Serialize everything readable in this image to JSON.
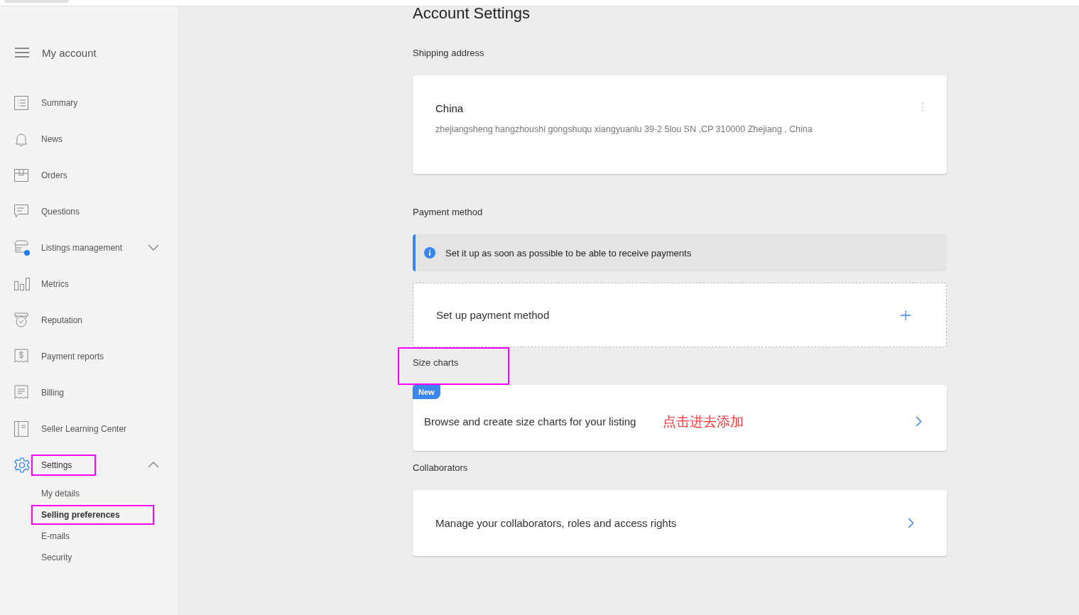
{
  "sidebar": {
    "title": "My account",
    "items": [
      {
        "label": "Summary",
        "selected": false,
        "highlighted": false
      },
      {
        "label": "News",
        "selected": false,
        "highlighted": false
      },
      {
        "label": "Orders",
        "selected": false,
        "highlighted": false
      },
      {
        "label": "Questions",
        "selected": false,
        "highlighted": false
      },
      {
        "label": "Listings management",
        "selected": false,
        "highlighted": false,
        "expanded": false
      },
      {
        "label": "Metrics",
        "selected": false,
        "highlighted": false
      },
      {
        "label": "Reputation",
        "selected": false,
        "highlighted": false
      },
      {
        "label": "Payment reports",
        "selected": false,
        "highlighted": false
      },
      {
        "label": "Billing",
        "selected": false,
        "highlighted": false
      },
      {
        "label": "Seller Learning Center",
        "selected": false,
        "highlighted": false
      },
      {
        "label": "Settings",
        "selected": true,
        "highlighted": true,
        "expanded": true,
        "children": [
          {
            "label": "My details",
            "selected": false,
            "highlighted": false
          },
          {
            "label": "Selling preferences",
            "selected": true,
            "highlighted": true
          },
          {
            "label": "E-mails",
            "selected": false,
            "highlighted": false
          },
          {
            "label": "Security",
            "selected": false,
            "highlighted": false
          }
        ]
      }
    ]
  },
  "main": {
    "title": "Account Settings",
    "sections": [
      {
        "kind": "address",
        "heading": "Shipping address",
        "highlighted": false,
        "country": "China",
        "address": "zhejiangsheng hangzhoushi gongshuqu xiangyuanlu 39-2 5lou SN ,CP 310000 Zhejiang , China"
      },
      {
        "kind": "payment",
        "heading": "Payment method",
        "highlighted": false,
        "notice": "Set it up as soon as possible to be able to receive payments",
        "action": "Set up payment method"
      },
      {
        "kind": "link",
        "heading": "Size charts",
        "highlighted": true,
        "badge": "New",
        "text": "Browse and create size charts for your listing",
        "annotation": "点击进去添加"
      },
      {
        "kind": "link",
        "heading": "Collaborators",
        "highlighted": false,
        "text": "Manage your collaborators, roles and access rights"
      }
    ]
  }
}
